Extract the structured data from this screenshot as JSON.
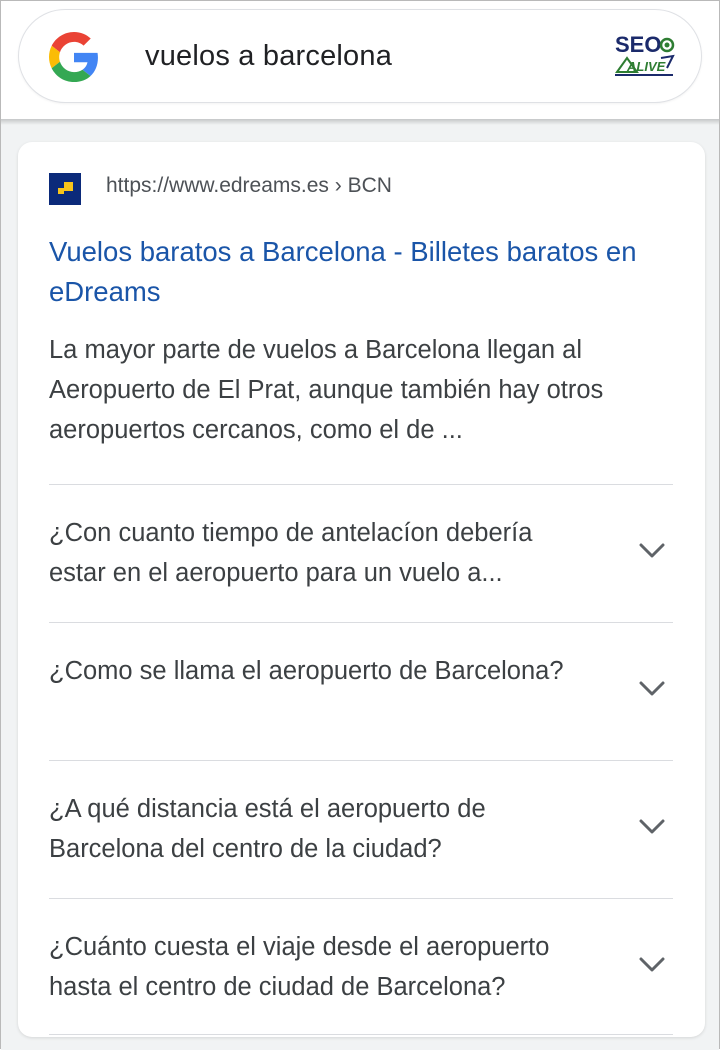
{
  "search": {
    "query": "vuelos a barcelona",
    "brand_logo_top": "SEO",
    "brand_logo_bottom": "ALIVE"
  },
  "result": {
    "url": "https://www.edreams.es › BCN",
    "title": "Vuelos baratos a Barcelona - Billetes baratos en eDreams",
    "snippet": "La mayor parte de vuelos a Barcelona llegan al Aeropuerto de El Prat, aunque también hay otros aeropuertos cercanos, como el de ..."
  },
  "faqs": [
    "¿Con cuanto tiempo de antelacíon debería estar en el aeropuerto para un vuelo a...",
    "¿Como se llama el aeropuerto de Barcelona?",
    "¿A qué distancia está el aeropuerto de Barcelona del centro de la ciudad?",
    "¿Cuánto cuesta el viaje desde el aeropuerto hasta el centro de ciudad de Barcelona?"
  ],
  "colors": {
    "link": "#1a55a8",
    "text": "#3c4043",
    "url": "#4d5156",
    "seo_green": "#2e7d32",
    "seo_navy": "#1b2a6b"
  },
  "icons": {
    "search_logo": "google-g-icon",
    "favicon": "edreams-favicon-icon",
    "expand": "chevron-down-icon"
  }
}
